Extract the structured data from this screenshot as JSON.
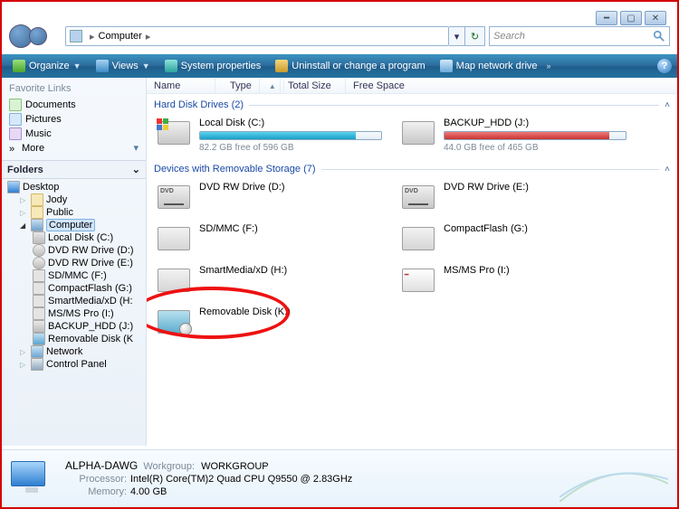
{
  "nav": {
    "location": "Computer",
    "search_placeholder": "Search"
  },
  "toolbar": {
    "organize": "Organize",
    "views": "Views",
    "sysprop": "System properties",
    "uninstall": "Uninstall or change a program",
    "mapdrive": "Map network drive"
  },
  "sidebar": {
    "fav_header": "Favorite Links",
    "favs": {
      "documents": "Documents",
      "pictures": "Pictures",
      "music": "Music",
      "more": "More"
    },
    "folders_header": "Folders",
    "tree": {
      "desktop": "Desktop",
      "jody": "Jody",
      "public": "Public",
      "computer": "Computer",
      "drives": [
        "Local Disk (C:)",
        "DVD RW Drive (D:)",
        "DVD RW Drive (E:)",
        "SD/MMC (F:)",
        "CompactFlash (G:)",
        "SmartMedia/xD (H:",
        "MS/MS Pro (I:)",
        "BACKUP_HDD (J:)",
        "Removable Disk (K"
      ],
      "network": "Network",
      "controlpanel": "Control Panel"
    }
  },
  "columns": {
    "name": "Name",
    "type": "Type",
    "totalsize": "Total Size",
    "freespace": "Free Space"
  },
  "groups": {
    "hdd": {
      "title": "Hard Disk Drives (2)"
    },
    "removable": {
      "title": "Devices with Removable Storage (7)"
    }
  },
  "hdd": [
    {
      "name": "Local Disk (C:)",
      "freetext": "82.2 GB free of 596 GB",
      "fillpct": 86,
      "barclass": "blue"
    },
    {
      "name": "BACKUP_HDD (J:)",
      "freetext": "44.0 GB free of 465 GB",
      "fillpct": 91,
      "barclass": "red"
    }
  ],
  "removable": [
    "DVD RW Drive (D:)",
    "DVD RW Drive (E:)",
    "SD/MMC (F:)",
    "CompactFlash (G:)",
    "SmartMedia/xD (H:)",
    "MS/MS Pro (I:)",
    "Removable Disk (K:)"
  ],
  "status": {
    "computer_name": "ALPHA-DAWG",
    "workgroup_lbl": "Workgroup:",
    "workgroup": "WORKGROUP",
    "processor_lbl": "Processor:",
    "processor": "Intel(R) Core(TM)2 Quad CPU    Q9550  @ 2.83GHz",
    "memory_lbl": "Memory:",
    "memory": "4.00 GB"
  },
  "more_glyph": "»"
}
